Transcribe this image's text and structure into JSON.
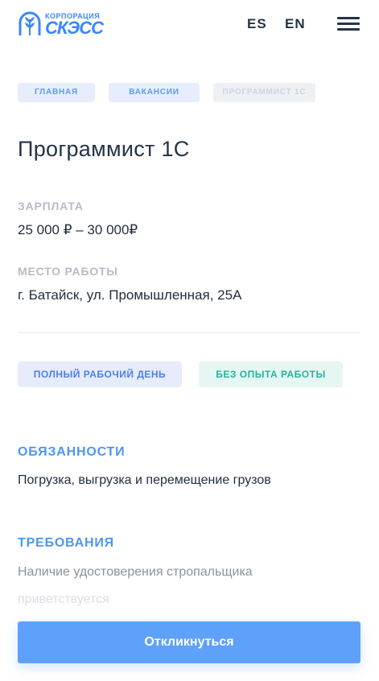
{
  "header": {
    "logo_top": "КОРПОРАЦИЯ",
    "logo_main": "СКЭСС",
    "lang_es": "ES",
    "lang_en": "EN",
    "menu_icon": "hamburger-icon"
  },
  "breadcrumbs": [
    "ГЛАВНАЯ",
    "ВАКАНСИИ",
    "ПРОГРАММИСТ 1С"
  ],
  "vacancy": {
    "title": "Программист 1С",
    "salary_label": "ЗАРПЛАТА",
    "salary_value": "25 000 ₽ – 30 000₽",
    "place_label": "МЕСТО РАБОТЫ",
    "place_value": "г. Батайск, ул. Промышленная, 25А"
  },
  "tags": [
    "ПОЛНЫЙ РАБОЧИЙ ДЕНЬ",
    "БЕЗ ОПЫТА РАБОТЫ"
  ],
  "duties": {
    "heading": "ОБЯЗАННОСТИ",
    "text": "Погрузка, выгрузка и перемещение грузов"
  },
  "requirements": {
    "heading": "ТРЕБОВАНИЯ",
    "line1": "Наличие удостоверения стропальщика",
    "line2": "приветствуется"
  },
  "apply_button": "Откликнуться",
  "colors": {
    "accent": "#5ea1fb",
    "brand": "#3a86ff",
    "text": "#1f2d3d",
    "green_tag": "#23b59b"
  }
}
